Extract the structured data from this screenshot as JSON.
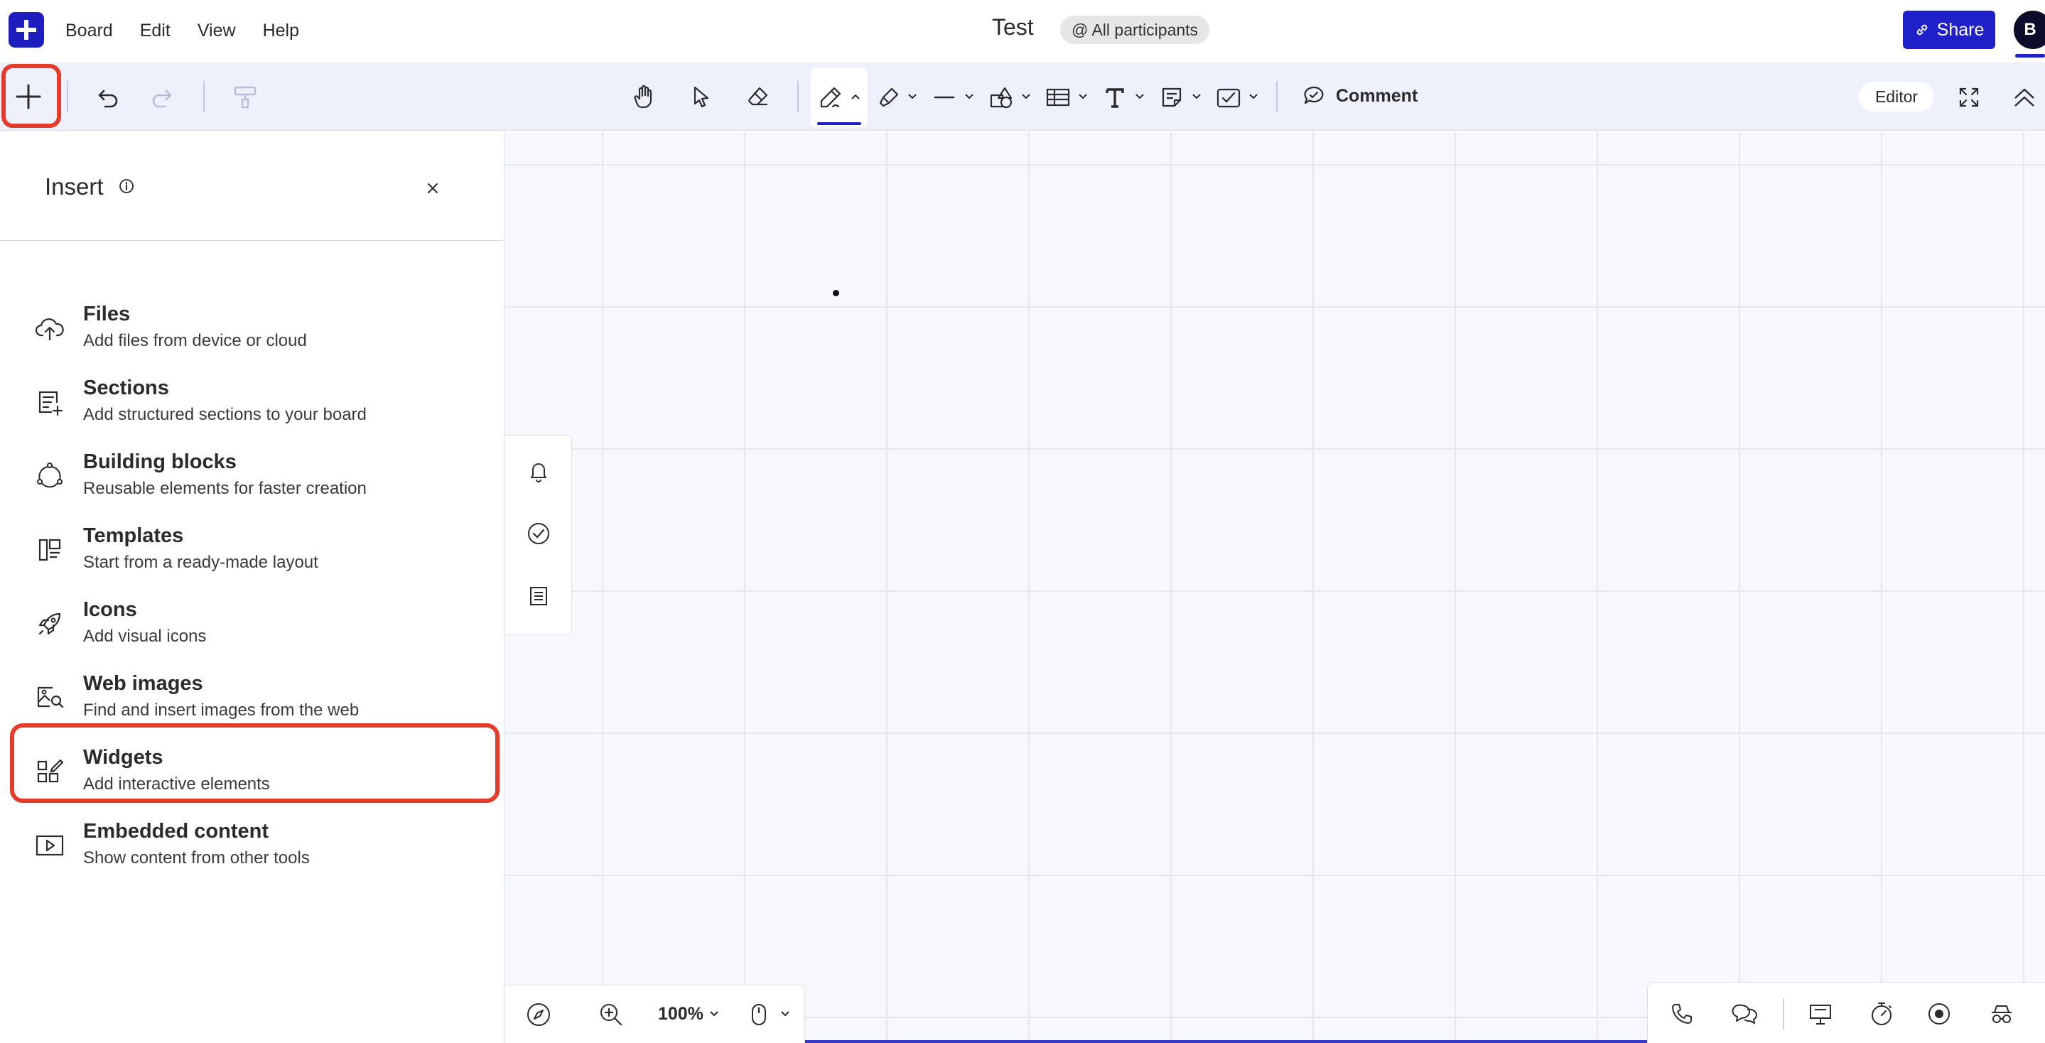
{
  "app": {
    "logo_icon": "plus-logo-icon",
    "brand_color": "#1e1ebf",
    "menu": [
      "Board",
      "Edit",
      "View",
      "Help"
    ],
    "board_title": "Test",
    "participants_label": "@ All participants",
    "share_label": "Share",
    "avatar_initial": "B"
  },
  "toolbar": {
    "tools": [
      "plus-icon",
      "undo-icon",
      "redo-icon",
      "format-painter-icon",
      "hand-icon",
      "pointer-icon",
      "eraser-icon",
      "pen-icon",
      "highlighter-icon",
      "line-icon",
      "shapes-icon",
      "table-icon",
      "text-icon",
      "sticky-note-icon",
      "checkbox-icon"
    ],
    "comment_label": "Comment",
    "editor_label": "Editor",
    "highlight_color": "#e53b2b"
  },
  "insert_panel": {
    "title": "Insert",
    "items": [
      {
        "title": "Files",
        "desc": "Add files from device or cloud",
        "icon": "cloud-upload-icon"
      },
      {
        "title": "Sections",
        "desc": "Add structured sections to your board",
        "icon": "sections-icon"
      },
      {
        "title": "Building blocks",
        "desc": "Reusable elements for faster creation",
        "icon": "building-blocks-icon"
      },
      {
        "title": "Templates",
        "desc": "Start from a ready-made layout",
        "icon": "templates-icon"
      },
      {
        "title": "Icons",
        "desc": "Add visual icons",
        "icon": "rocket-icon"
      },
      {
        "title": "Web images",
        "desc": "Find and insert images from the web",
        "icon": "image-search-icon"
      },
      {
        "title": "Widgets",
        "desc": "Add interactive elements",
        "icon": "widgets-icon"
      },
      {
        "title": "Embedded content",
        "desc": "Show content from other tools",
        "icon": "play-embed-icon"
      }
    ]
  },
  "canvas": {
    "side_rail": [
      "bell-icon",
      "check-circle-icon",
      "list-icon"
    ],
    "zoom_level": "100%",
    "bottom_right_tools": [
      "phone-icon",
      "chat-icon",
      "presentation-icon",
      "timer-icon",
      "record-icon",
      "incognito-icon"
    ]
  }
}
